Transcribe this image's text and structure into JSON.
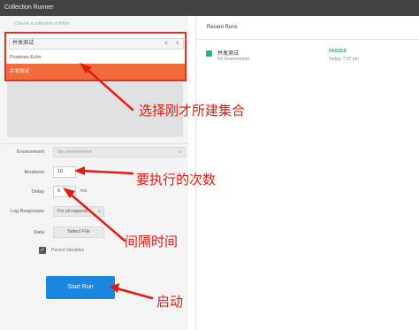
{
  "window": {
    "title": "Collection Runner"
  },
  "collection_dropdown": {
    "faint_label": "Choose a collection or folder",
    "selected": "并发测试",
    "options": [
      "Postman Echo",
      "并发测试"
    ],
    "highlighted_option": "并发测试"
  },
  "form": {
    "environment_label": "Environment",
    "environment_value": "No environment",
    "iterations_label": "Iterations",
    "iterations_value": "10",
    "delay_label": "Delay",
    "delay_value": "0",
    "delay_unit": "ms",
    "log_label": "Log Responses",
    "log_value": "For all requests",
    "data_label": "Data",
    "select_file_label": "Select File",
    "persist_label": "Persist Variables",
    "persist_checked": true,
    "start_button": "Start Run"
  },
  "recent_runs": {
    "header": "Recent Runs",
    "items": [
      {
        "name": "并发测试",
        "environment": "No Environment",
        "status": "PASSED",
        "time": "Today, 7:37 pm"
      }
    ]
  },
  "annotations": {
    "select_collection": "选择刚才所建集合",
    "iterations_note": "要执行的次数",
    "delay_note": "间隔时间",
    "start_note": "启动"
  },
  "colors": {
    "accent_orange": "#f26b3a",
    "start_blue": "#1a86e0",
    "passed_green": "#26b47f",
    "annotation_red": "#e01b10"
  }
}
